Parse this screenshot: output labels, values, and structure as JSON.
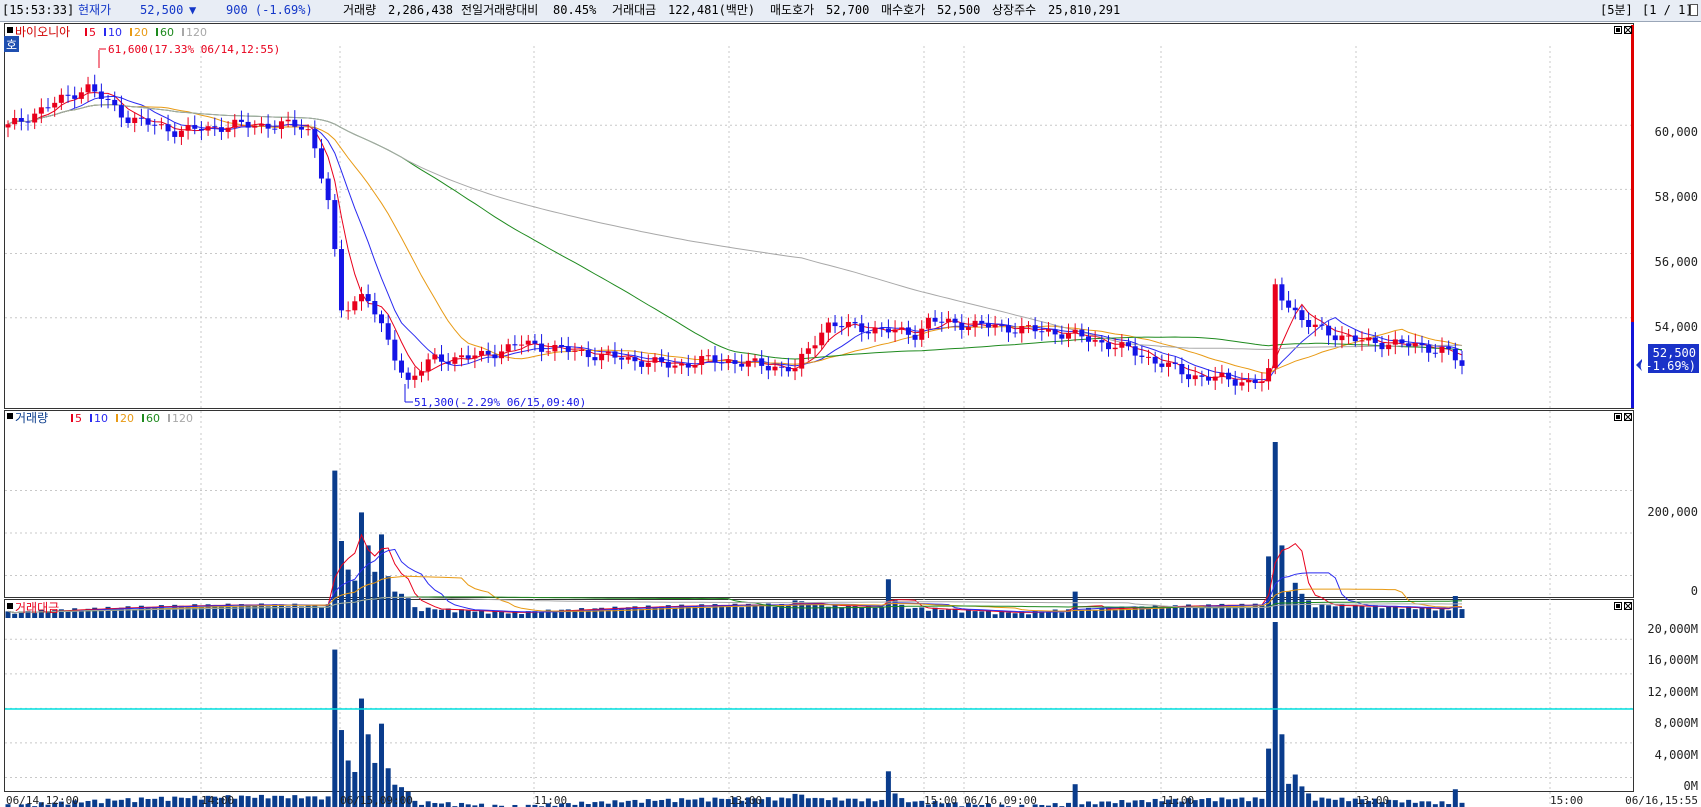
{
  "topbar": {
    "time": "[15:53:33]",
    "price_label": "현재가",
    "price": "52,500",
    "down_icon": "▼",
    "change": "900  (-1.69%)",
    "volume_label": "거래량",
    "volume": "2,286,438",
    "prev_vol_ratio_label": "전일거래량대비",
    "prev_vol_ratio": "80.45%",
    "amount_label": "거래대금",
    "amount": "122,481(백만)",
    "ask_label": "매도호가",
    "ask": "52,700",
    "bid_label": "매수호가",
    "bid": "52,500",
    "shares_label": "상장주수",
    "shares": "25,810,291",
    "period": "[5분]",
    "page": "[1 / 1]"
  },
  "price_pane": {
    "badge": "호",
    "name": "바이오니아",
    "ma_labels": [
      "5",
      "10",
      "20",
      "60",
      "120"
    ],
    "high_annotation": "61,600(17.33% 06/14,12:55)",
    "low_annotation": "51,300(-2.29% 06/15,09:40)",
    "y_ticks": [
      "60,000",
      "58,000",
      "56,000",
      "54,000"
    ],
    "current_price": "52,500",
    "current_change": "(-1.69%)"
  },
  "volume_pane": {
    "name": "거래량",
    "ma_labels": [
      "5",
      "10",
      "20",
      "60",
      "120"
    ],
    "y_ticks": [
      "200,000",
      "0"
    ]
  },
  "amount_pane": {
    "name": "거래대금",
    "y_ticks": [
      "20,000M",
      "16,000M",
      "12,000M",
      "8,000M",
      "4,000M",
      "0M"
    ]
  },
  "time_axis": [
    "06/14,12:00",
    "14:00",
    "06/15,09:00",
    "11:00",
    "13:00",
    "15:00",
    "06/16,09:00",
    "11:00",
    "13:00",
    "15:00",
    "06/16,15:55"
  ],
  "colors": {
    "up": "#e8001c",
    "down": "#1414e6",
    "ma5": "#e8001c",
    "ma10": "#2a2af0",
    "ma20": "#e89a14",
    "ma60": "#1e8a1e",
    "ma120": "#a8a8a8",
    "volume_bar": "#0a3c8c",
    "ref_line": "#00e0e0",
    "price_tag_bg": "#1a32c8"
  },
  "chart_data": {
    "type": "candlestick",
    "title": "바이오니아",
    "interval": "5분",
    "x_range": [
      "06/14,12:00",
      "06/16,15:55"
    ],
    "price_ylim": [
      50500,
      62500
    ],
    "high": {
      "value": 61600,
      "change": "17.33%",
      "time": "06/14,12:55"
    },
    "low": {
      "value": 51300,
      "change": "-2.29%",
      "time": "06/15,09:40"
    },
    "close_path": [
      {
        "time": "06/14,12:00",
        "close": 59950
      },
      {
        "time": "06/14,12:55",
        "close": 61200
      },
      {
        "time": "06/14,14:00",
        "close": 59800
      },
      {
        "time": "06/14,15:20",
        "close": 60000
      },
      {
        "time": "06/15,09:00",
        "close": 56500
      },
      {
        "time": "06/15,09:40",
        "close": 52000
      },
      {
        "time": "06/15,11:00",
        "close": 53100
      },
      {
        "time": "06/15,13:00",
        "close": 52400
      },
      {
        "time": "06/15,14:30",
        "close": 53800
      },
      {
        "time": "06/16,09:00",
        "close": 53600
      },
      {
        "time": "06/16,10:00",
        "close": 53500
      },
      {
        "time": "06/16,11:30",
        "close": 52100
      },
      {
        "time": "06/16,13:00",
        "close": 52000
      },
      {
        "time": "06/16,13:10",
        "close": 55000
      },
      {
        "time": "06/16,14:00",
        "close": 53300
      },
      {
        "time": "06/16,15:55",
        "close": 52500
      }
    ],
    "volume_ylim": [
      0,
      400000
    ],
    "volume_peaks": [
      {
        "time": "06/15,09:00",
        "value": 335000
      },
      {
        "time": "06/15,09:40",
        "value": 240000
      },
      {
        "time": "06/16,13:10",
        "value": 400000
      }
    ],
    "amount_ylim_millions": [
      0,
      22000
    ],
    "amount_ref_line_millions": 10000,
    "amount_peaks_millions": [
      {
        "time": "06/15,09:00",
        "value": 18000
      },
      {
        "time": "06/15,09:40",
        "value": 12200
      },
      {
        "time": "06/16,13:10",
        "value": 21500
      }
    ]
  }
}
